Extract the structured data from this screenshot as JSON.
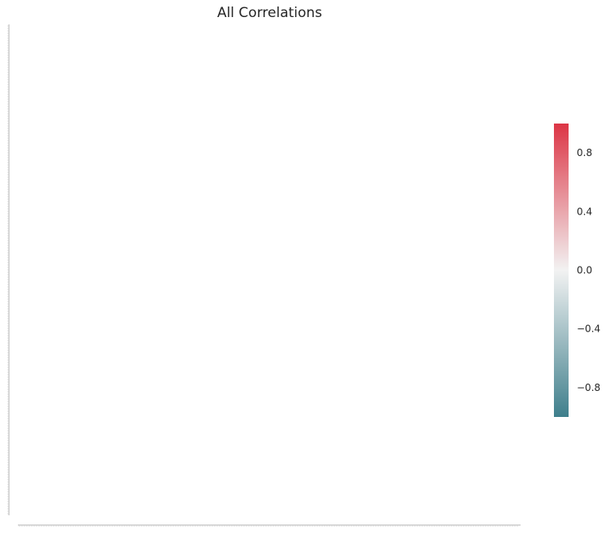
{
  "chart_data": {
    "type": "heatmap",
    "title": "All Correlations",
    "xlabel": "",
    "ylabel": "",
    "mask": "upper-triangle",
    "cells": "not visible (lower-triangle cells render white at this resolution)",
    "colorbar": {
      "vmin": -1.0,
      "vmax": 1.0,
      "center": 0.0,
      "ticks": [
        0.8,
        0.4,
        0.0,
        -0.4,
        -0.8
      ],
      "tick_labels": [
        "0.8",
        "0.4",
        "0.0",
        "−0.4",
        "−0.8"
      ],
      "colormap": "diverging",
      "color_low": "#3f7f8c",
      "color_mid": "#f2f2f2",
      "color_high": "#dc3545"
    },
    "grid": false
  }
}
